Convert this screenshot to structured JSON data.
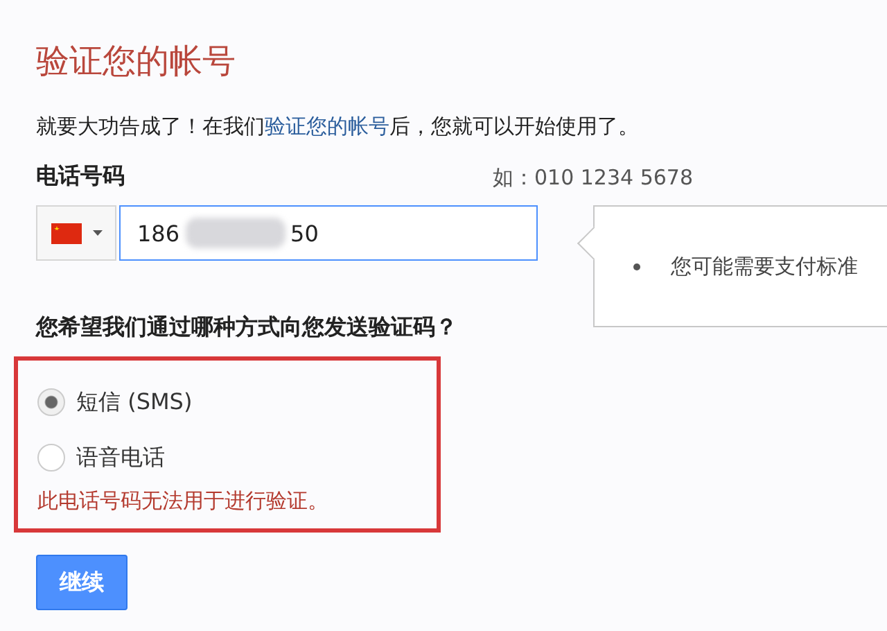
{
  "title": "验证您的帐号",
  "intro": {
    "before": "就要大功告成了！在我们",
    "link": "验证您的帐号",
    "after": "后，您就可以开始使用了。"
  },
  "phone": {
    "label": "电话号码",
    "hint": "如：010 1234 5678",
    "value_start": "186",
    "value_end": "50",
    "redacted": true
  },
  "tooltip": {
    "items": [
      "您可能需要支付标准"
    ]
  },
  "question": "您希望我们通过哪种方式向您发送验证码？",
  "methods": [
    {
      "label": "短信 (SMS)",
      "selected": true
    },
    {
      "label": "语音电话",
      "selected": false
    }
  ],
  "error": "此电话号码无法用于进行验证。",
  "highlighted": true,
  "button": "继续"
}
